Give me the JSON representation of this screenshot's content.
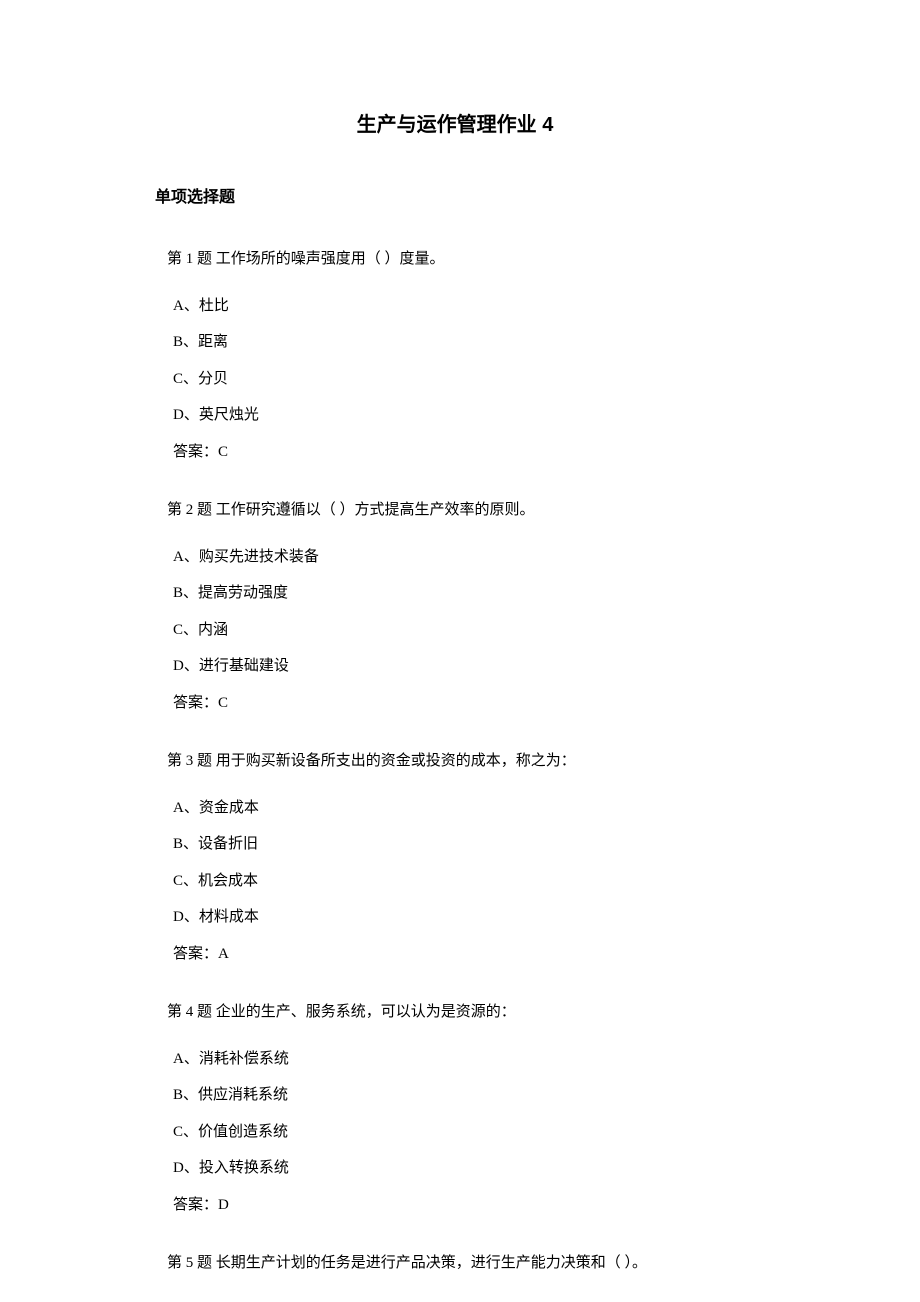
{
  "title": "生产与运作管理作业 4",
  "section": "单项选择题",
  "questions": [
    {
      "prompt": "第 1 题 工作场所的噪声强度用（ ）度量。",
      "options": [
        "A、杜比",
        "B、距离",
        "C、分贝",
        "D、英尺烛光"
      ],
      "answer": "答案：C"
    },
    {
      "prompt": "第 2 题 工作研究遵循以（ ）方式提高生产效率的原则。",
      "options": [
        "A、购买先进技术装备",
        "B、提高劳动强度",
        "C、内涵",
        "D、进行基础建设"
      ],
      "answer": "答案：C"
    },
    {
      "prompt": "第 3 题 用于购买新设备所支出的资金或投资的成本，称之为：",
      "options": [
        "A、资金成本",
        "B、设备折旧",
        "C、机会成本",
        "D、材料成本"
      ],
      "answer": "答案：A"
    },
    {
      "prompt": "第 4 题 企业的生产、服务系统，可以认为是资源的：",
      "options": [
        "A、消耗补偿系统",
        "B、供应消耗系统",
        "C、价值创造系统",
        "D、投入转换系统"
      ],
      "answer": "答案：D"
    },
    {
      "prompt": "第 5 题 长期生产计划的任务是进行产品决策，进行生产能力决策和（ ）。",
      "options": [],
      "answer": ""
    }
  ]
}
